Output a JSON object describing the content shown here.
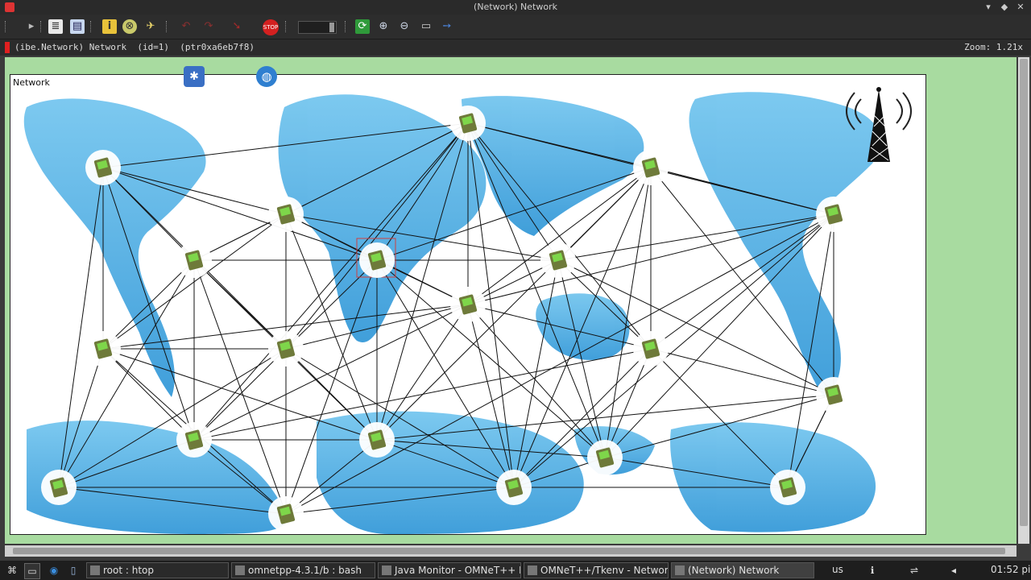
{
  "window": {
    "title": "(Network) Network"
  },
  "toolbar": {
    "items": [
      "run-icon",
      "layout-icon",
      "inspect-icon",
      "object-tree-icon",
      "info-icon",
      "module-icon",
      "rocket-icon",
      "undo-icon",
      "redo-icon",
      "step-icon",
      "stop-icon",
      "speed-slider",
      "refresh-icon",
      "zoom-in-icon",
      "zoom-out-icon",
      "screenshot-icon",
      "arrow-icon"
    ]
  },
  "infobar": {
    "path": "(ibe.Network) Network  (id=1)  (ptr0xa6eb7f8)",
    "zoom": "Zoom: 1.21x"
  },
  "network": {
    "label": "Network"
  },
  "taskbar": {
    "tasks": [
      {
        "label": "root : htop"
      },
      {
        "label": "omnetpp-4.3.1/b : bash"
      },
      {
        "label": "Java Monitor - OMNeT++ ID"
      },
      {
        "label": "OMNeT++/Tkenv - Network"
      },
      {
        "label": "(Network) Network"
      }
    ],
    "keyboard": "us",
    "clock": "01:52 pi"
  }
}
